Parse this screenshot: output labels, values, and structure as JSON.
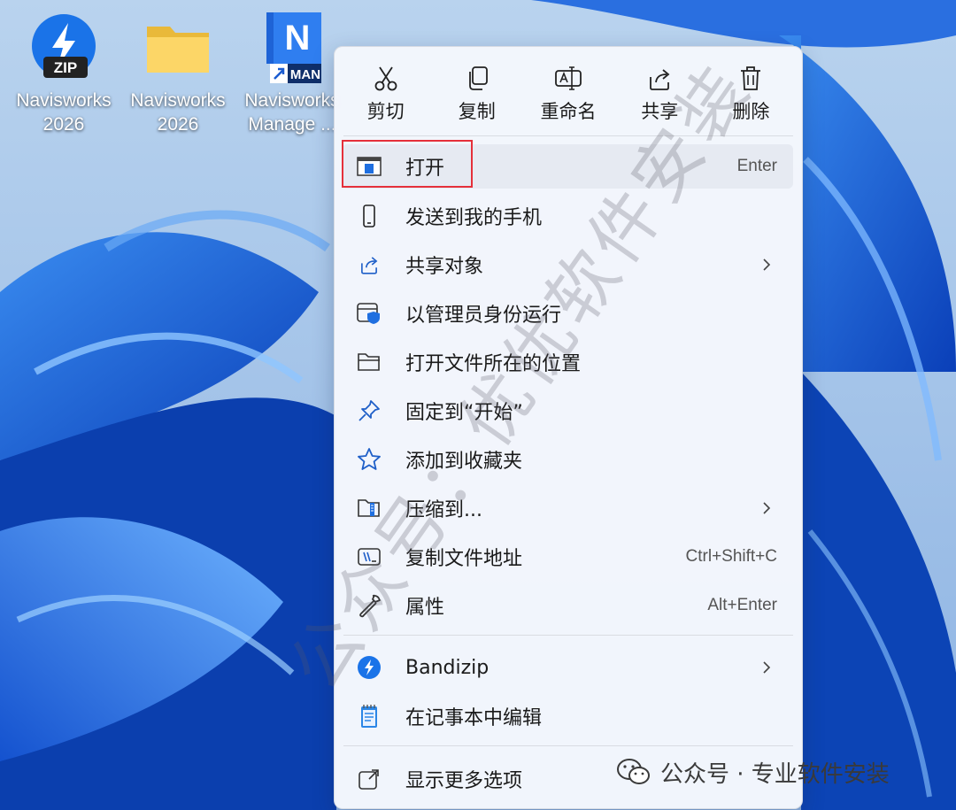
{
  "desktop": {
    "icons": [
      {
        "name": "Navisworks\n2026",
        "badge": "ZIP",
        "icon": "bandizip-archive-icon"
      },
      {
        "name": "Navisworks\n2026",
        "icon": "folder-icon"
      },
      {
        "name": "Navisworks\nManage ...",
        "badge_letter": "N",
        "badge": "MAN",
        "icon": "navisworks-manage-shortcut-icon"
      }
    ]
  },
  "context_menu": {
    "quick_actions": [
      {
        "label": "剪切",
        "icon": "scissors-icon"
      },
      {
        "label": "复制",
        "icon": "copy-icon"
      },
      {
        "label": "重命名",
        "icon": "rename-icon"
      },
      {
        "label": "共享",
        "icon": "share-icon"
      },
      {
        "label": "删除",
        "icon": "trash-icon"
      }
    ],
    "items": [
      {
        "label": "打开",
        "shortcut": "Enter",
        "icon": "open-app-icon",
        "highlighted": true
      },
      {
        "label": "发送到我的手机",
        "shortcut": "",
        "icon": "phone-icon"
      },
      {
        "label": "共享对象",
        "shortcut": "",
        "icon": "share-icon",
        "submenu": true
      },
      {
        "label": "以管理员身份运行",
        "shortcut": "",
        "icon": "admin-shield-icon"
      },
      {
        "label": "打开文件所在的位置",
        "shortcut": "",
        "icon": "folder-open-icon"
      },
      {
        "label": "固定到“开始”",
        "shortcut": "",
        "icon": "pin-icon"
      },
      {
        "label": "添加到收藏夹",
        "shortcut": "",
        "icon": "star-icon"
      },
      {
        "label": "压缩到...",
        "shortcut": "",
        "icon": "zip-folder-icon",
        "submenu": true
      },
      {
        "label": "复制文件地址",
        "shortcut": "Ctrl+Shift+C",
        "icon": "copy-path-icon"
      },
      {
        "label": "属性",
        "shortcut": "Alt+Enter",
        "icon": "wrench-icon"
      }
    ],
    "extra_items": [
      {
        "label": "Bandizip",
        "shortcut": "",
        "icon": "bandizip-icon",
        "submenu": true
      },
      {
        "label": "在记事本中编辑",
        "shortcut": "",
        "icon": "notepad-icon"
      }
    ],
    "more_options": {
      "label": "显示更多选项",
      "icon": "more-options-icon"
    }
  },
  "watermark": {
    "text": "公众号：优优软件安装"
  },
  "footer_mark": {
    "text": "公众号 · 专业软件安装",
    "icon": "wechat-icon"
  },
  "colors": {
    "highlight_border": "#e5303a",
    "accent_blue": "#1f6fe0"
  }
}
